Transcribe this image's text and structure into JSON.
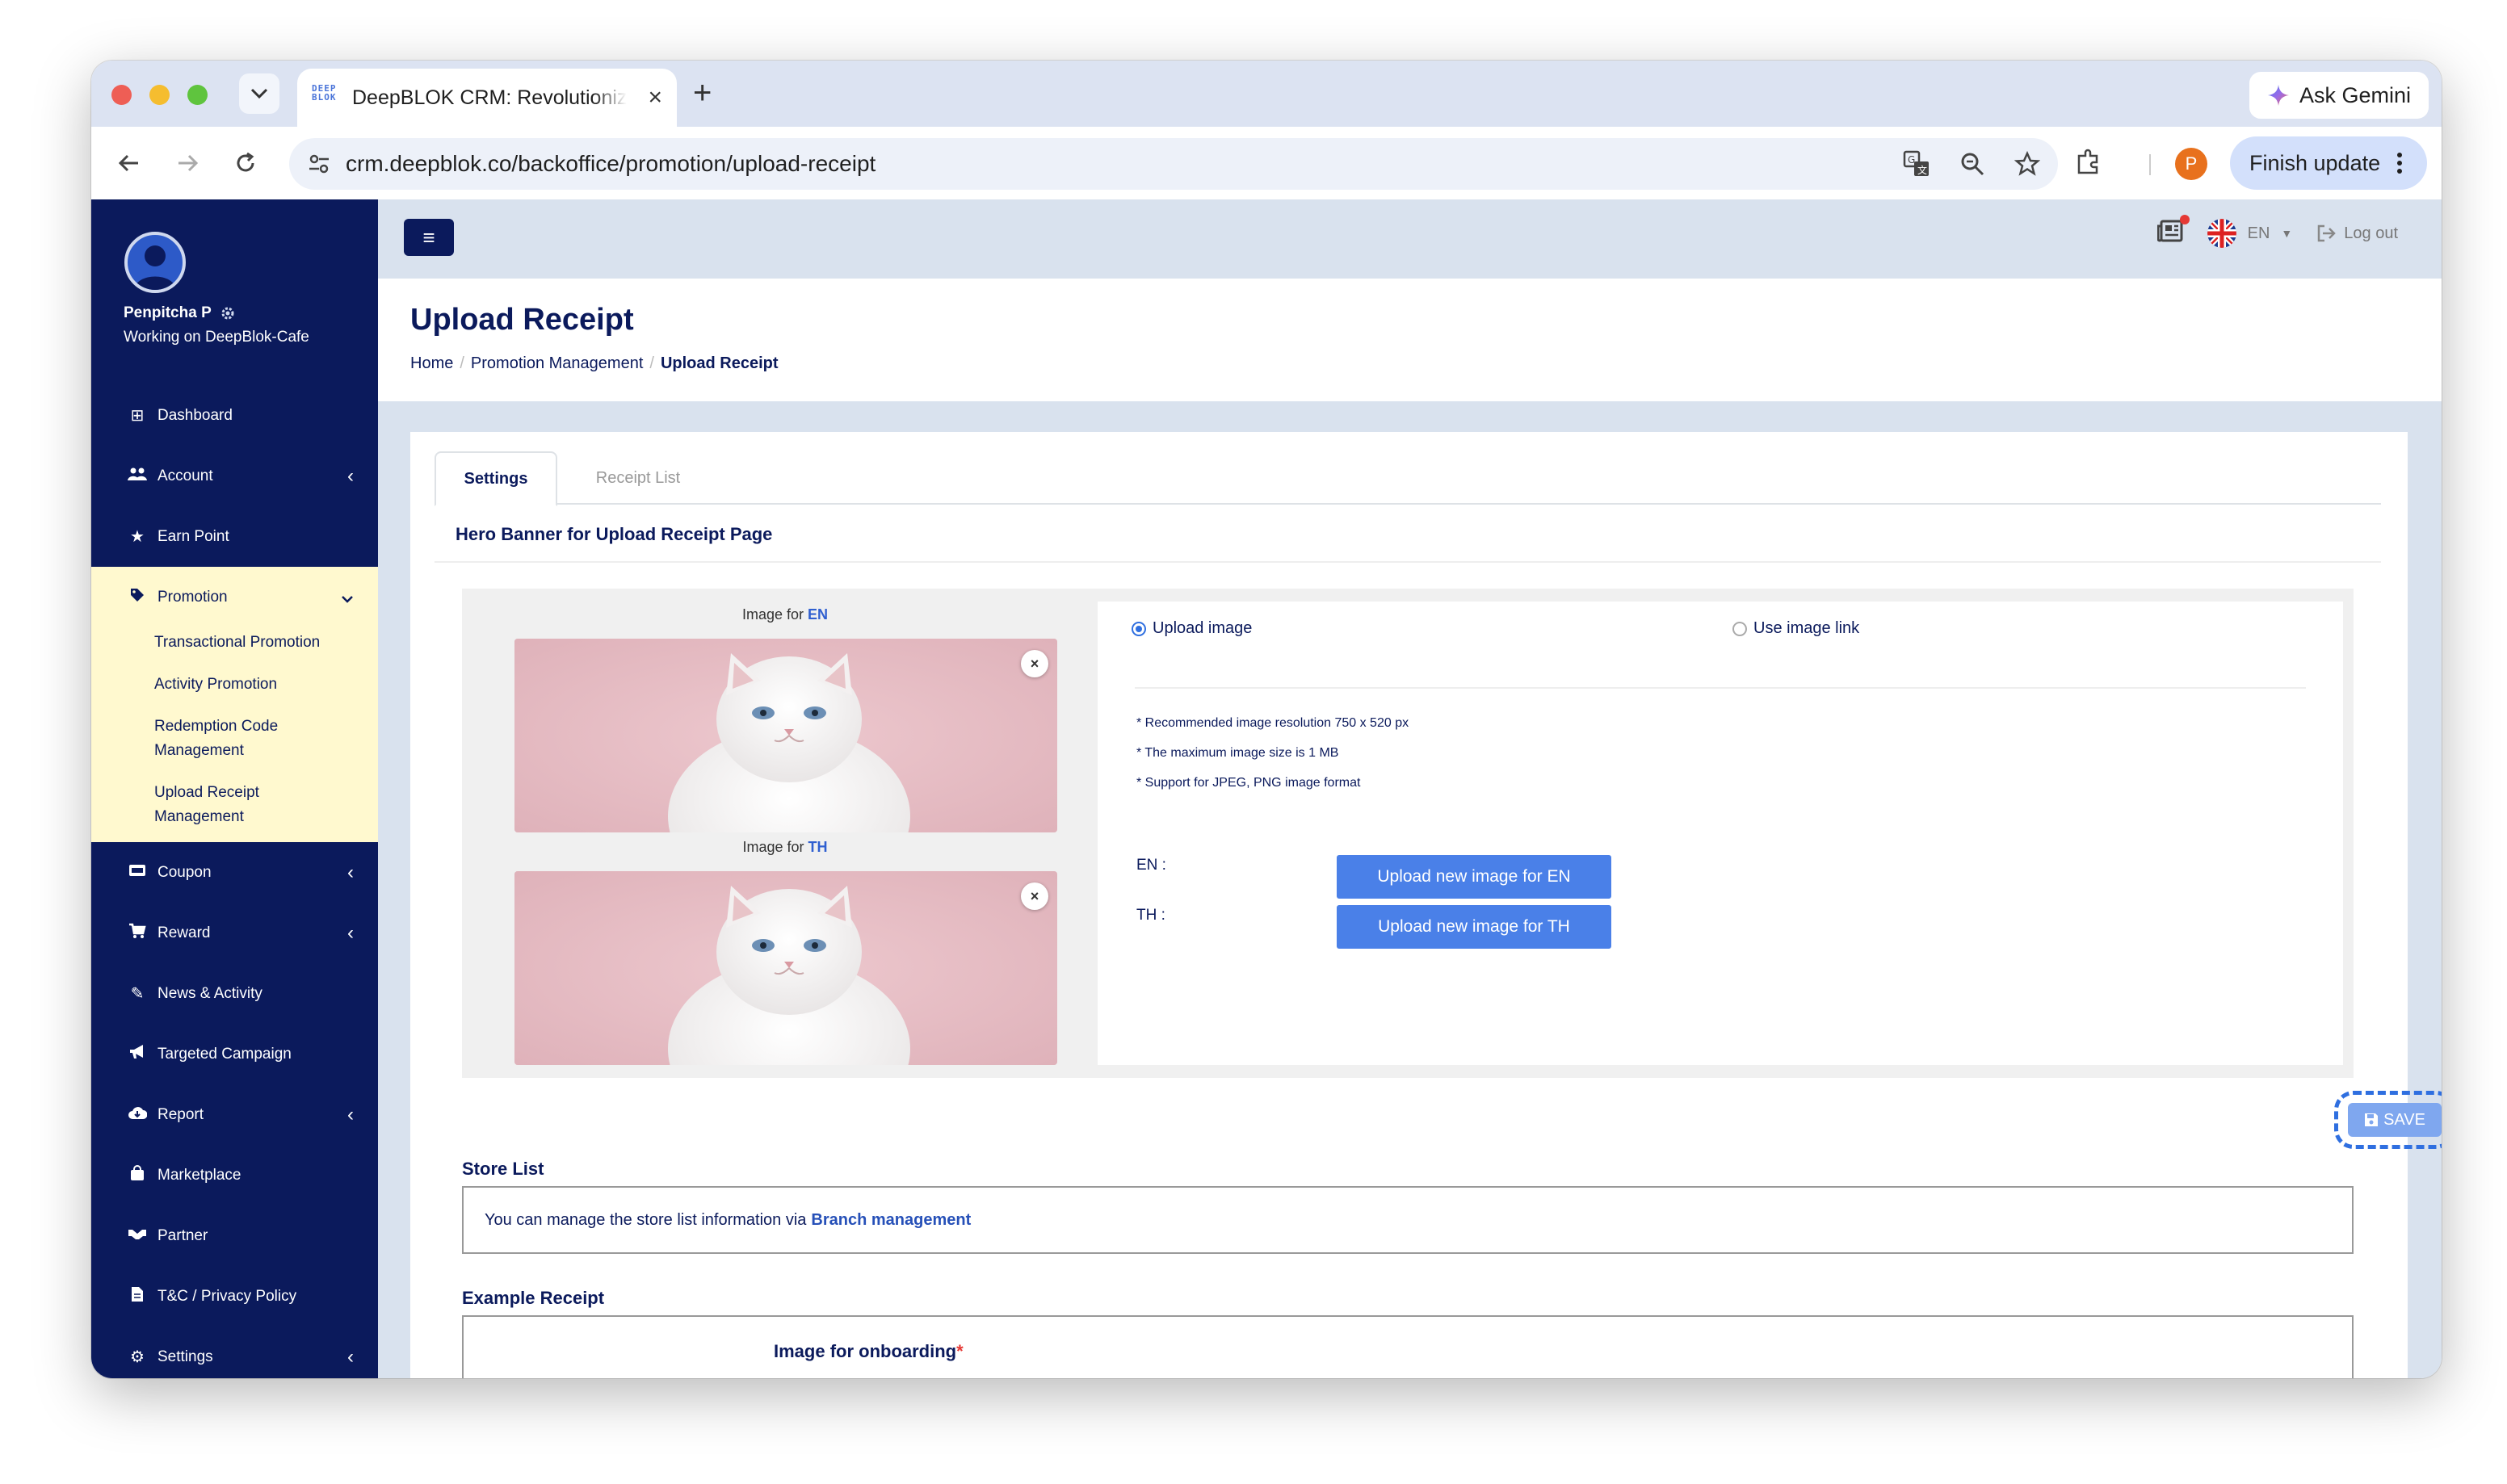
{
  "browser": {
    "tab_title": "DeepBLOK CRM: Revolutionize",
    "favicon_text": "DEEP BLOK",
    "url": "crm.deepblok.co/backoffice/promotion/upload-receipt",
    "gemini_label": "Ask Gemini",
    "finish_update_label": "Finish update",
    "profile_initial": "P"
  },
  "sidebar": {
    "user_name": "Penpitcha P",
    "workspace": "Working on DeepBlok-Cafe",
    "items": [
      {
        "label": "Dashboard",
        "icon": "dashboard-icon"
      },
      {
        "label": "Account",
        "icon": "users-icon"
      },
      {
        "label": "Earn Point",
        "icon": "star-icon"
      },
      {
        "label": "Promotion",
        "icon": "tag-icon"
      },
      {
        "label": "Coupon",
        "icon": "coupon-icon"
      },
      {
        "label": "Reward",
        "icon": "cart-icon"
      },
      {
        "label": "News & Activity",
        "icon": "edit-icon"
      },
      {
        "label": "Targeted Campaign",
        "icon": "megaphone-icon"
      },
      {
        "label": "Report",
        "icon": "cloud-download-icon"
      },
      {
        "label": "Marketplace",
        "icon": "shopping-bag-icon"
      },
      {
        "label": "Partner",
        "icon": "handshake-icon"
      },
      {
        "label": "T&C / Privacy Policy",
        "icon": "file-icon"
      },
      {
        "label": "Settings",
        "icon": "gear-icon"
      }
    ],
    "promotion_sub": [
      "Transactional Promotion",
      "Activity Promotion",
      "Redemption Code Management",
      "Upload Receipt Management"
    ]
  },
  "topbar": {
    "language": "EN",
    "logout_label": "Log out"
  },
  "page": {
    "title": "Upload Receipt",
    "breadcrumb": [
      "Home",
      "Promotion Management",
      "Upload Receipt"
    ]
  },
  "tabs": [
    "Settings",
    "Receipt List"
  ],
  "hero": {
    "section_title": "Hero Banner for Upload Receipt Page",
    "image_for_prefix": "Image for",
    "lang_en": "EN",
    "lang_th": "TH",
    "option_upload": "Upload image",
    "option_link": "Use image link",
    "notes": [
      "* Recommended image resolution 750 x 520 px",
      "* The maximum image size is 1 MB",
      "* Support for JPEG, PNG image format"
    ],
    "label_en": "EN :",
    "label_th": "TH :",
    "upload_en_label": "Upload new image for EN",
    "upload_th_label": "Upload new image for TH",
    "save_label": "SAVE"
  },
  "store_list": {
    "title": "Store List",
    "text": "You can manage the store list information via",
    "link": "Branch management"
  },
  "example_receipt": {
    "title": "Example Receipt",
    "onboarding_label": "Image for onboarding",
    "required_mark": "*"
  }
}
